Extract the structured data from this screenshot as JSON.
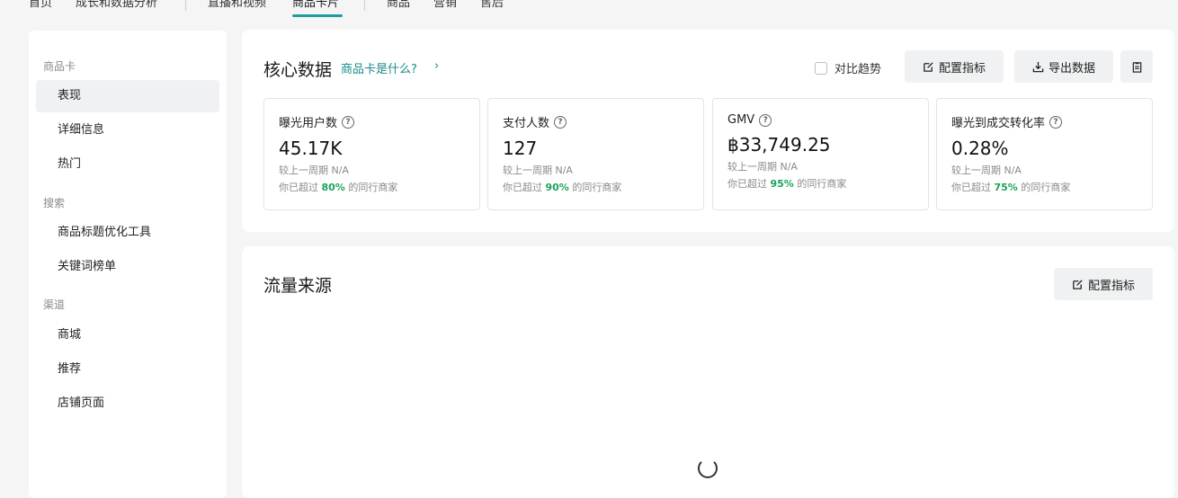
{
  "topnav": {
    "items": [
      "首页",
      "成长和数据分析",
      "直播和视频",
      "商品卡片",
      "商品",
      "营销",
      "售后"
    ],
    "active_index": 3
  },
  "sidebar": {
    "groups": [
      {
        "label": "商品卡",
        "items": [
          "表现",
          "详细信息",
          "热门"
        ]
      },
      {
        "label": "搜索",
        "items": [
          "商品标题优化工具",
          "关键词榜单"
        ]
      },
      {
        "label": "渠道",
        "items": [
          "商城",
          "推荐",
          "店铺页面"
        ]
      }
    ],
    "active_item": "表现"
  },
  "core": {
    "title": "核心数据",
    "help_link": "商品卡是什么?",
    "compare_trend": "对比趋势",
    "config_button": "配置指标",
    "export_button": "导出数据",
    "metrics": [
      {
        "label": "曝光用户数",
        "value": "45.17K",
        "compare_label": "较上一周期",
        "compare_value": "N/A",
        "peer_prefix": "你已超过",
        "peer_pct": "80%",
        "peer_suffix": "的同行商家"
      },
      {
        "label": "支付人数",
        "value": "127",
        "compare_label": "较上一周期",
        "compare_value": "N/A",
        "peer_prefix": "你已超过",
        "peer_pct": "90%",
        "peer_suffix": "的同行商家"
      },
      {
        "label": "GMV",
        "value": "฿33,749.25",
        "compare_label": "较上一周期",
        "compare_value": "N/A",
        "peer_prefix": "你已超过",
        "peer_pct": "95%",
        "peer_suffix": "的同行商家"
      },
      {
        "label": "曝光到成交转化率",
        "value": "0.28%",
        "compare_label": "较上一周期",
        "compare_value": "N/A",
        "peer_prefix": "你已超过",
        "peer_pct": "75%",
        "peer_suffix": "的同行商家"
      }
    ]
  },
  "traffic": {
    "title": "流量来源",
    "config_button": "配置指标"
  },
  "colors": {
    "accent": "#1a9e9e",
    "link": "#1a8a8a",
    "positive": "#1aa35a"
  }
}
